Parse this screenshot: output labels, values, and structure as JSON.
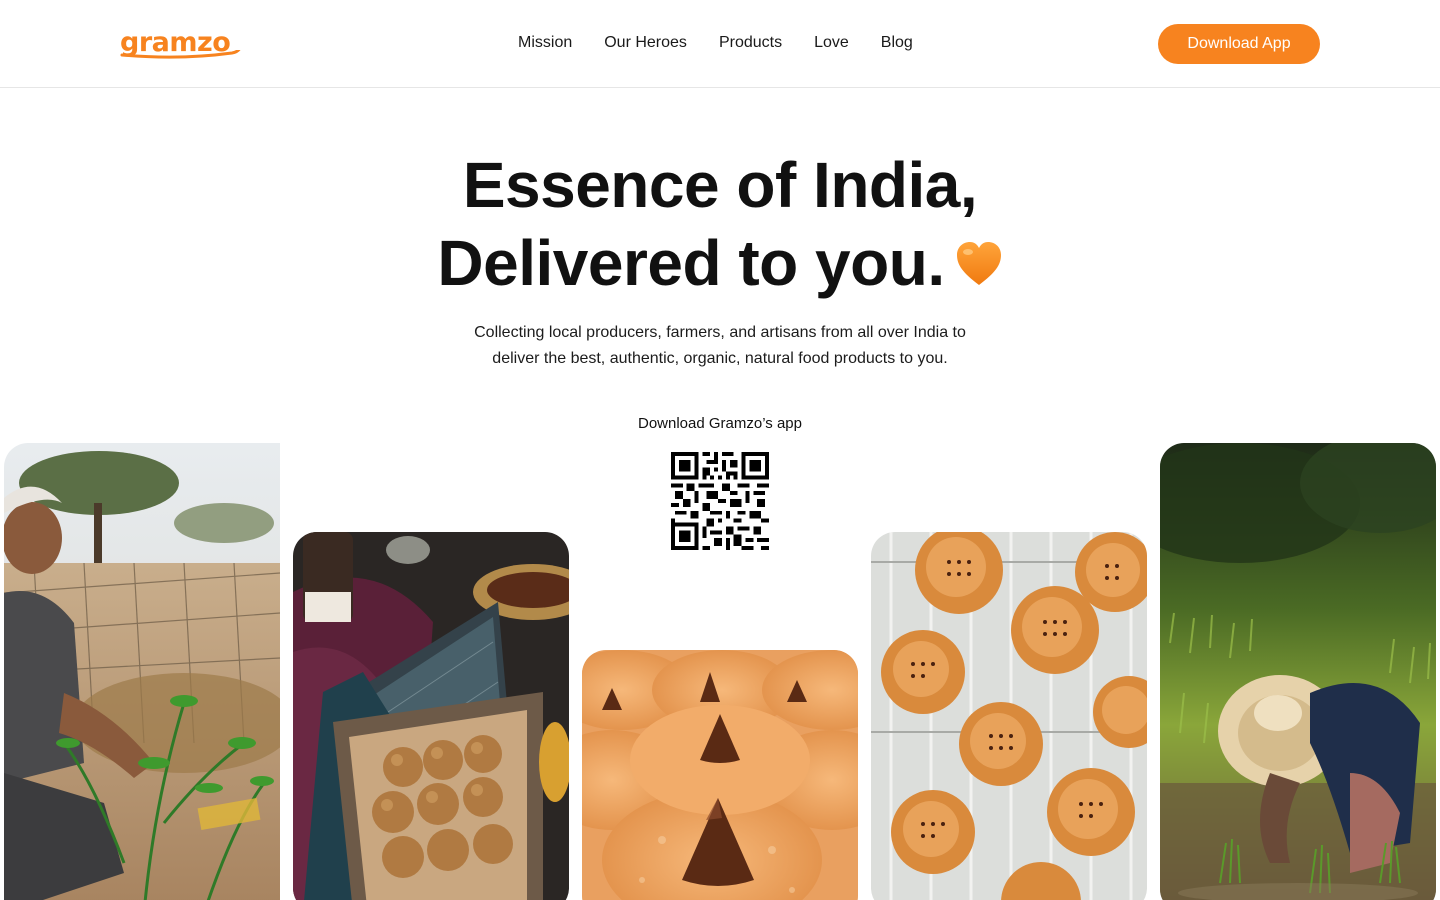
{
  "brand": {
    "logo_text": "gramzo",
    "accent_color": "#f7831f"
  },
  "nav": {
    "items": [
      {
        "label": "Mission"
      },
      {
        "label": "Our Heroes"
      },
      {
        "label": "Products"
      },
      {
        "label": "Love"
      },
      {
        "label": "Blog"
      }
    ]
  },
  "header": {
    "cta_label": "Download App"
  },
  "hero": {
    "title_line1": "Essence of India,",
    "title_line2": "Delivered to you.",
    "emoji_icon": "orange-heart-icon",
    "subtitle_line1": "Collecting local producers, farmers, and artisans from all over India to",
    "subtitle_line2": "deliver the best, authentic,  organic, natural food products to you."
  },
  "download": {
    "label": "Download Gramzo’s app",
    "qr_icon": "qr-code-icon"
  },
  "gallery": {
    "images": [
      {
        "name": "farmer-with-plants-photo"
      },
      {
        "name": "laddoo-box-photo"
      },
      {
        "name": "chocolate-kiss-cookies-photo"
      },
      {
        "name": "cookies-on-rack-photo"
      },
      {
        "name": "rice-planting-farmer-photo"
      }
    ]
  }
}
